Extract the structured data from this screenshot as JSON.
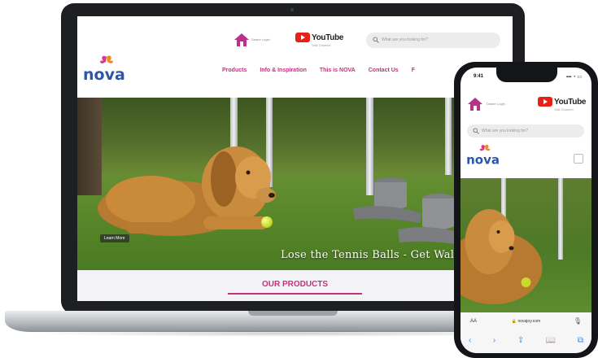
{
  "site": {
    "home_label": "Dealer Login",
    "youtube": {
      "word": "YouTube",
      "sub": "Visit Channel"
    },
    "search_placeholder": "What are you looking for?",
    "brand": "nova",
    "nav": [
      "Products",
      "Info & Inspiration",
      "This is NOVA",
      "Contact Us",
      "F"
    ]
  },
  "hero": {
    "badge": "Learn More",
    "caption": "Lose the Tennis Balls - Get Walker"
  },
  "products": {
    "title": "OUR PRODUCTS"
  },
  "phone": {
    "time": "9:41",
    "status": "▪▪▪ ◔ ▭",
    "home_label": "Dealer Login",
    "search_placeholder": "What are you looking for?",
    "url_aa": "AA",
    "url": "🔒 novajoy.com",
    "mic": "🎙",
    "toolbar": [
      "‹",
      "›",
      "⇪",
      "📖",
      "⧉"
    ]
  },
  "colors": {
    "brand_pink": "#c3327f",
    "youtube_red": "#e62117",
    "logo_blue": "#2c56a8",
    "logo_orange": "#f08a1c"
  }
}
